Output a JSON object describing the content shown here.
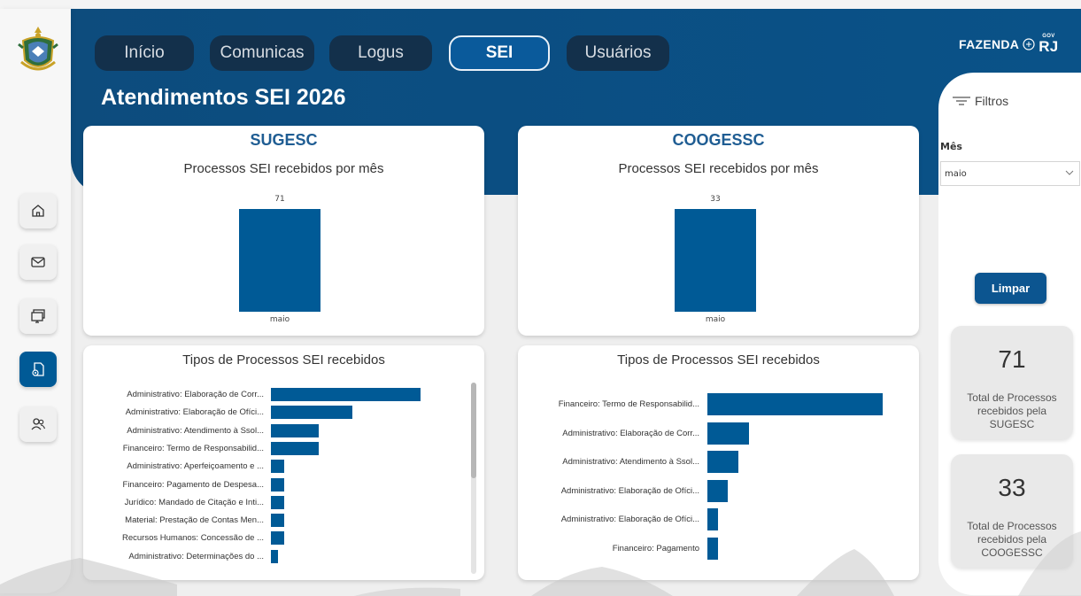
{
  "nav": {
    "tabs": [
      {
        "label": "Início",
        "active": false
      },
      {
        "label": "Comunicas",
        "active": false
      },
      {
        "label": "Logus",
        "active": false
      },
      {
        "label": "SEI",
        "active": true
      },
      {
        "label": "Usuários",
        "active": false
      }
    ]
  },
  "brand": {
    "name": "FAZENDA",
    "gov_small": "GOV",
    "gov_big": "RJ"
  },
  "page_title": "Atendimentos SEI 2026",
  "sidebar": {
    "icons": [
      "home-icon",
      "mail-icon",
      "monitor-icon",
      "document-settings-icon",
      "users-icon"
    ],
    "active_index": 3
  },
  "sugesc": {
    "heading": "SUGESC",
    "monthly_title": "Processos SEI recebidos por mês",
    "types_title": "Tipos de Processos SEI recebidos"
  },
  "coogessc": {
    "heading": "COOGESSC",
    "monthly_title": "Processos SEI recebidos por mês",
    "types_title": "Tipos de Processos SEI recebidos"
  },
  "filters": {
    "title": "Filtros",
    "month_label": "Mês",
    "month_value": "maio",
    "clear_label": "Limpar"
  },
  "kpis": [
    {
      "value": "71",
      "desc": "Total de Processos recebidos pela SUGESC"
    },
    {
      "value": "33",
      "desc": "Total de Processos recebidos pela COOGESSC"
    }
  ],
  "colors": {
    "accent": "#005a96",
    "header": "#0b4e82",
    "tab": "#13304b"
  },
  "chart_data": [
    {
      "type": "bar",
      "title": "Processos SEI recebidos por mês",
      "categories": [
        "maio"
      ],
      "values": [
        71
      ],
      "ylim": [
        0,
        71
      ]
    },
    {
      "type": "bar",
      "title": "Processos SEI recebidos por mês",
      "categories": [
        "maio"
      ],
      "values": [
        33
      ],
      "ylim": [
        0,
        33
      ]
    },
    {
      "type": "bar",
      "orientation": "horizontal",
      "title": "Tipos de Processos SEI recebidos",
      "categories": [
        "Administrativo: Elaboração de Corr...",
        "Administrativo: Elaboração de Ofíci...",
        "Administrativo: Atendimento à Ssol...",
        "Financeiro: Termo de Responsabilid...",
        "Administrativo: Aperfeiçoamento e ...",
        "Financeiro: Pagamento de Despesa...",
        "Jurídico: Mandado de Citação e Inti...",
        "Material: Prestação de Contas Men...",
        "Recursos Humanos: Concessão de ...",
        "Administrativo: Determinações do ..."
      ],
      "values": [
        22,
        12,
        7,
        7,
        2,
        2,
        2,
        2,
        2,
        1
      ]
    },
    {
      "type": "bar",
      "orientation": "horizontal",
      "title": "Tipos de Processos SEI recebidos",
      "categories": [
        "Financeiro: Termo de Responsabilid...",
        "Administrativo: Elaboração de Corr...",
        "Administrativo: Atendimento à Ssol...",
        "Administrativo: Elaboração de Ofíci...",
        "Administrativo: Elaboração de Ofíci...",
        "Financeiro: Pagamento"
      ],
      "values": [
        17,
        4,
        3,
        2,
        1,
        1
      ]
    }
  ]
}
